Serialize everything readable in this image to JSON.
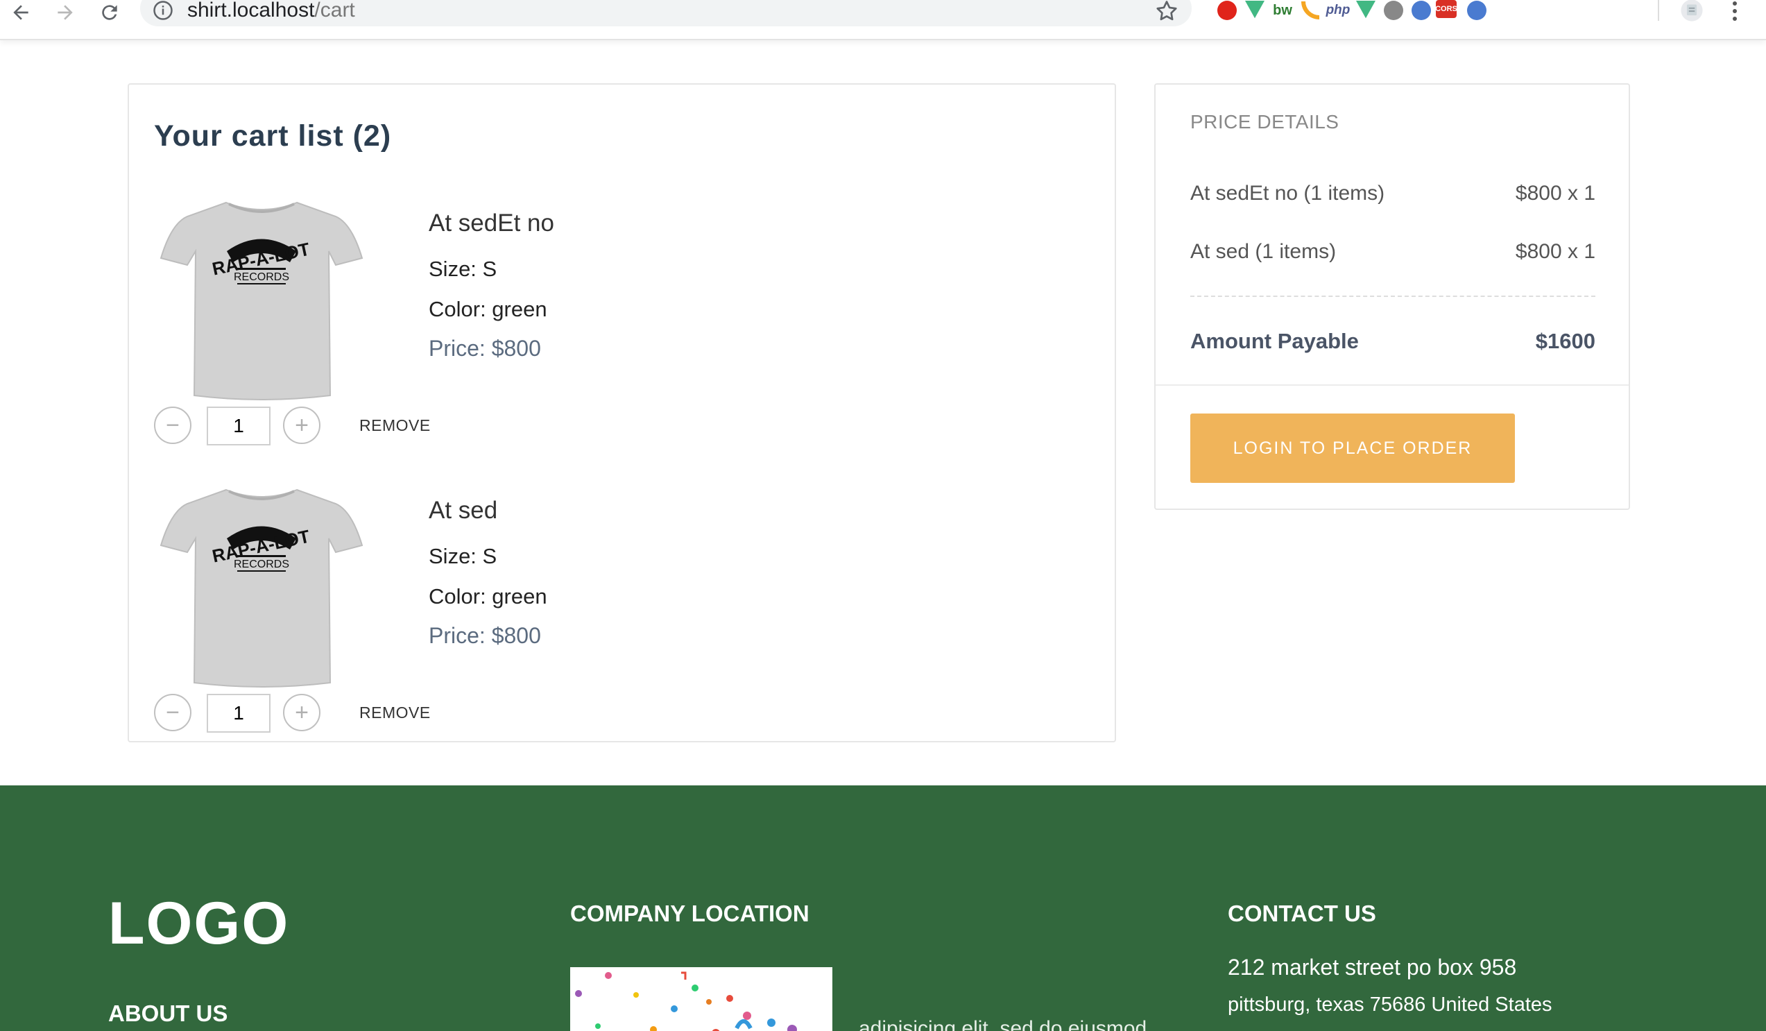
{
  "browser": {
    "url_host": "shirt.localhost",
    "url_path": "/cart",
    "extensions": [
      {
        "name": "adblock-icon",
        "glyph": "",
        "color": "#e0241b"
      },
      {
        "name": "vue-devtools-icon",
        "glyph": "",
        "color": "#41b883"
      },
      {
        "name": "bw-icon",
        "glyph": "bw",
        "color": "#2e7d32"
      },
      {
        "name": "rss-icon",
        "glyph": "",
        "color": "#f5a623"
      },
      {
        "name": "php-icon",
        "glyph": "php",
        "color": "#4f5b93"
      },
      {
        "name": "vue-icon",
        "glyph": "",
        "color": "#41b883"
      },
      {
        "name": "globe-icon",
        "glyph": "",
        "color": "#888888"
      },
      {
        "name": "sync-icon",
        "glyph": "",
        "color": "#4a7bd0"
      },
      {
        "name": "cors-icon",
        "glyph": "CORS",
        "color": "#d93025"
      },
      {
        "name": "link-icon",
        "glyph": "",
        "color": "#4a7bd0"
      }
    ]
  },
  "cart": {
    "title": "Your cart list (2)",
    "items": [
      {
        "name": "At sedEt no",
        "size": "Size: S",
        "color": "Color: green",
        "price": "Price: $800",
        "quantity": "1",
        "remove_label": "REMOVE",
        "shirt_text_top": "RAP-A-LOT",
        "shirt_text_bottom": "RECORDS"
      },
      {
        "name": "At sed",
        "size": "Size: S",
        "color": "Color: green",
        "price": "Price: $800",
        "quantity": "1",
        "remove_label": "REMOVE",
        "shirt_text_top": "RAP-A-LOT",
        "shirt_text_bottom": "RECORDS"
      }
    ]
  },
  "price_details": {
    "title": "PRICE DETAILS",
    "rows": [
      {
        "label": "At sedEt no (1 items)",
        "amount": "$800 x 1"
      },
      {
        "label": "At sed (1 items)",
        "amount": "$800 x 1"
      }
    ],
    "total_label": "Amount Payable",
    "total_amount": "$1600",
    "button_label": "LOGIN TO PLACE ORDER",
    "button_color": "#f0b45a"
  },
  "footer": {
    "background": "#32683d",
    "logo": "LOGO",
    "about": "ABOUT US",
    "location_title": "COMPANY LOCATION",
    "location_text": "adipisicing elit, sed do eiusmod",
    "contact_title": "CONTACT US",
    "address_line1": "212 market street po box 958",
    "address_line2": "pittsburg, texas 75686 United States"
  }
}
